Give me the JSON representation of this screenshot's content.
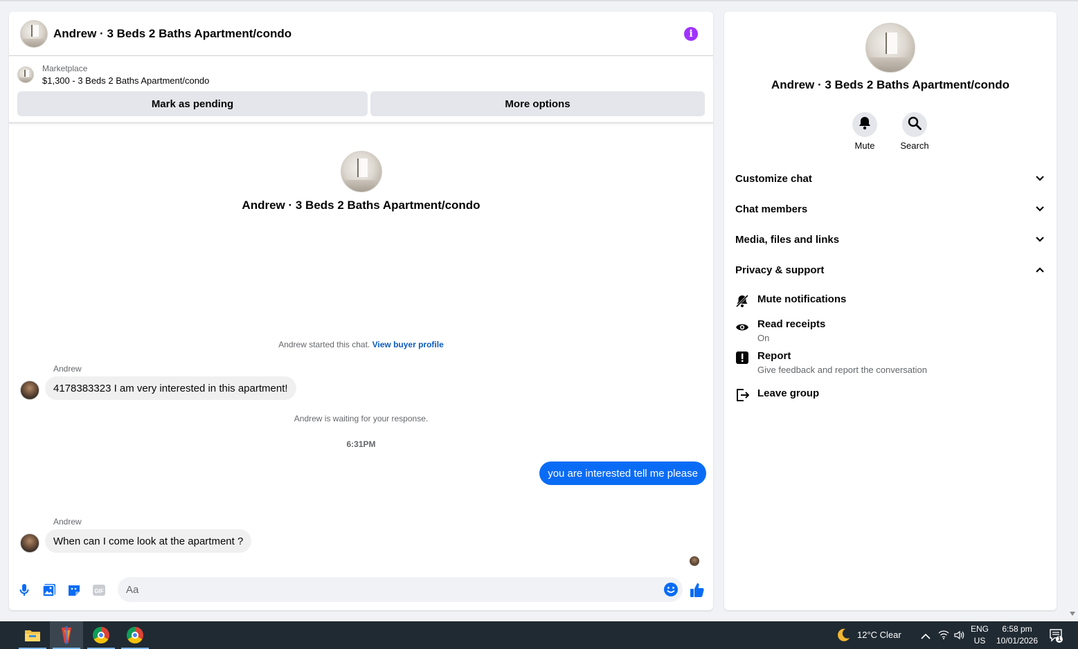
{
  "chat": {
    "header_title": "Andrew · 3 Beds 2 Baths Apartment/condo",
    "info_glyph": "i",
    "marketplace_label": "Marketplace",
    "marketplace_listing": "$1,300 - 3 Beds 2 Baths Apartment/condo",
    "mark_pending_label": "Mark as pending",
    "more_options_label": "More options",
    "intro_title": "Andrew · 3 Beds 2 Baths Apartment/condo",
    "started_text": "Andrew started this chat.",
    "view_buyer_link": "View buyer profile",
    "messages": [
      {
        "sender": "Andrew",
        "text": "4178383323 I am very interested in this apartment!"
      },
      {
        "system": "Andrew is waiting for your response."
      },
      {
        "time": "6:31PM"
      },
      {
        "outgoing": "you are interested tell me please"
      },
      {
        "sender": "Andrew",
        "text": "When can I come look at the apartment ?"
      }
    ],
    "composer_placeholder": "Aa",
    "accent_color": "#0a6cf5",
    "info_color": "#a033ff"
  },
  "side": {
    "title": "Andrew · 3 Beds 2 Baths Apartment/condo",
    "mute_label": "Mute",
    "search_label": "Search",
    "sections": [
      "Customize chat",
      "Chat members",
      "Media, files and links",
      "Privacy & support"
    ],
    "options": [
      {
        "icon": "bell-slash-icon",
        "title": "Mute notifications",
        "sub": ""
      },
      {
        "icon": "eye-icon",
        "title": "Read receipts",
        "sub": "On"
      },
      {
        "icon": "report-icon",
        "title": "Report",
        "sub": "Give feedback and report the conversation"
      },
      {
        "icon": "leave-icon",
        "title": "Leave group",
        "sub": ""
      }
    ]
  },
  "taskbar": {
    "weather": "12°C  Clear",
    "lang_top": "ENG",
    "lang_bottom": "US",
    "time": "6:58 pm",
    "date": "10/01/2026",
    "notif_count": "1",
    "apps": [
      "file-explorer-icon",
      "app-icon",
      "chrome-icon",
      "chrome-icon"
    ]
  }
}
